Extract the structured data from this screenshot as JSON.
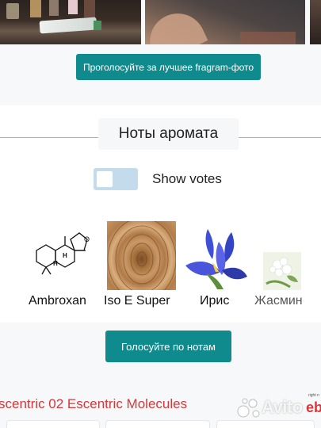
{
  "photos": [
    {
      "name": "user-photo-perfume-shelf"
    },
    {
      "name": "user-photo-hand"
    },
    {
      "name": "user-photo-partial"
    }
  ],
  "vote_photo_button": "Проголосуйте за лучшее fragram-фото",
  "notes": {
    "title": "Ноты аромата",
    "toggle_label": "Show votes",
    "toggle_on": false,
    "items": [
      {
        "label": "Ambroxan",
        "icon": "ambroxan-molecule-icon"
      },
      {
        "label": "Iso E Super",
        "icon": "wood-texture-image"
      },
      {
        "label": "Ирис",
        "icon": "iris-flower-image"
      },
      {
        "label": "Жасмин",
        "icon": "jasmine-flower-image"
      }
    ],
    "vote_button": "Голосуйте по нотам"
  },
  "perfume_title": "scentric 02 Escentric Molecules",
  "ad": {
    "watermark": "Avito",
    "ebay_small": "right n",
    "ebay_logo": "eb"
  },
  "colors": {
    "teal": "#0f8b8d",
    "toggle_bg": "#c3dbea",
    "title_red": "#d2393c",
    "rule": "#9db7c9"
  }
}
